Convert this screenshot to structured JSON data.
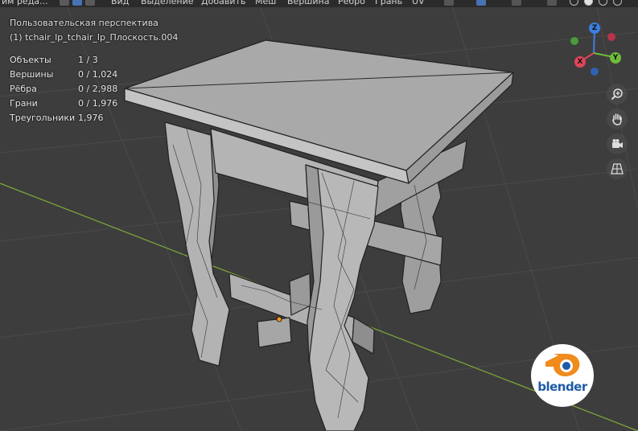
{
  "header": {
    "editor_mode": "им реда...",
    "menu": [
      "Вид",
      "Выделение",
      "Добавить",
      "Меш",
      "Вершина",
      "Ребро",
      "Грань",
      "UV"
    ]
  },
  "viewport": {
    "perspective": "Пользовательская перспектива",
    "object_name": "(1) tchair_lp_tchair_lp_Плоскость.004"
  },
  "stats": [
    {
      "label": "Объекты",
      "value": "1 / 3"
    },
    {
      "label": "Вершины",
      "value": "0 / 1,024"
    },
    {
      "label": "Рёбра",
      "value": "0 / 2,988"
    },
    {
      "label": "Грани",
      "value": "0 / 1,976"
    },
    {
      "label": "Треугольники",
      "value": "1,976"
    }
  ],
  "gizmo": {
    "x": "X",
    "y": "Y",
    "z": "Z",
    "colors": {
      "x": "#e0455a",
      "y": "#6dbd3a",
      "z": "#3b7fe0"
    }
  },
  "nav_tools": [
    "zoom-icon",
    "pan-hand-icon",
    "camera-icon",
    "grid-ortho-icon"
  ],
  "logo": {
    "text": "blender"
  },
  "colors": {
    "background": "#3d3d3d",
    "grid": "#4a4a4a",
    "x_axis": "#7ba33a",
    "mesh_face": "#a8a8a8"
  }
}
